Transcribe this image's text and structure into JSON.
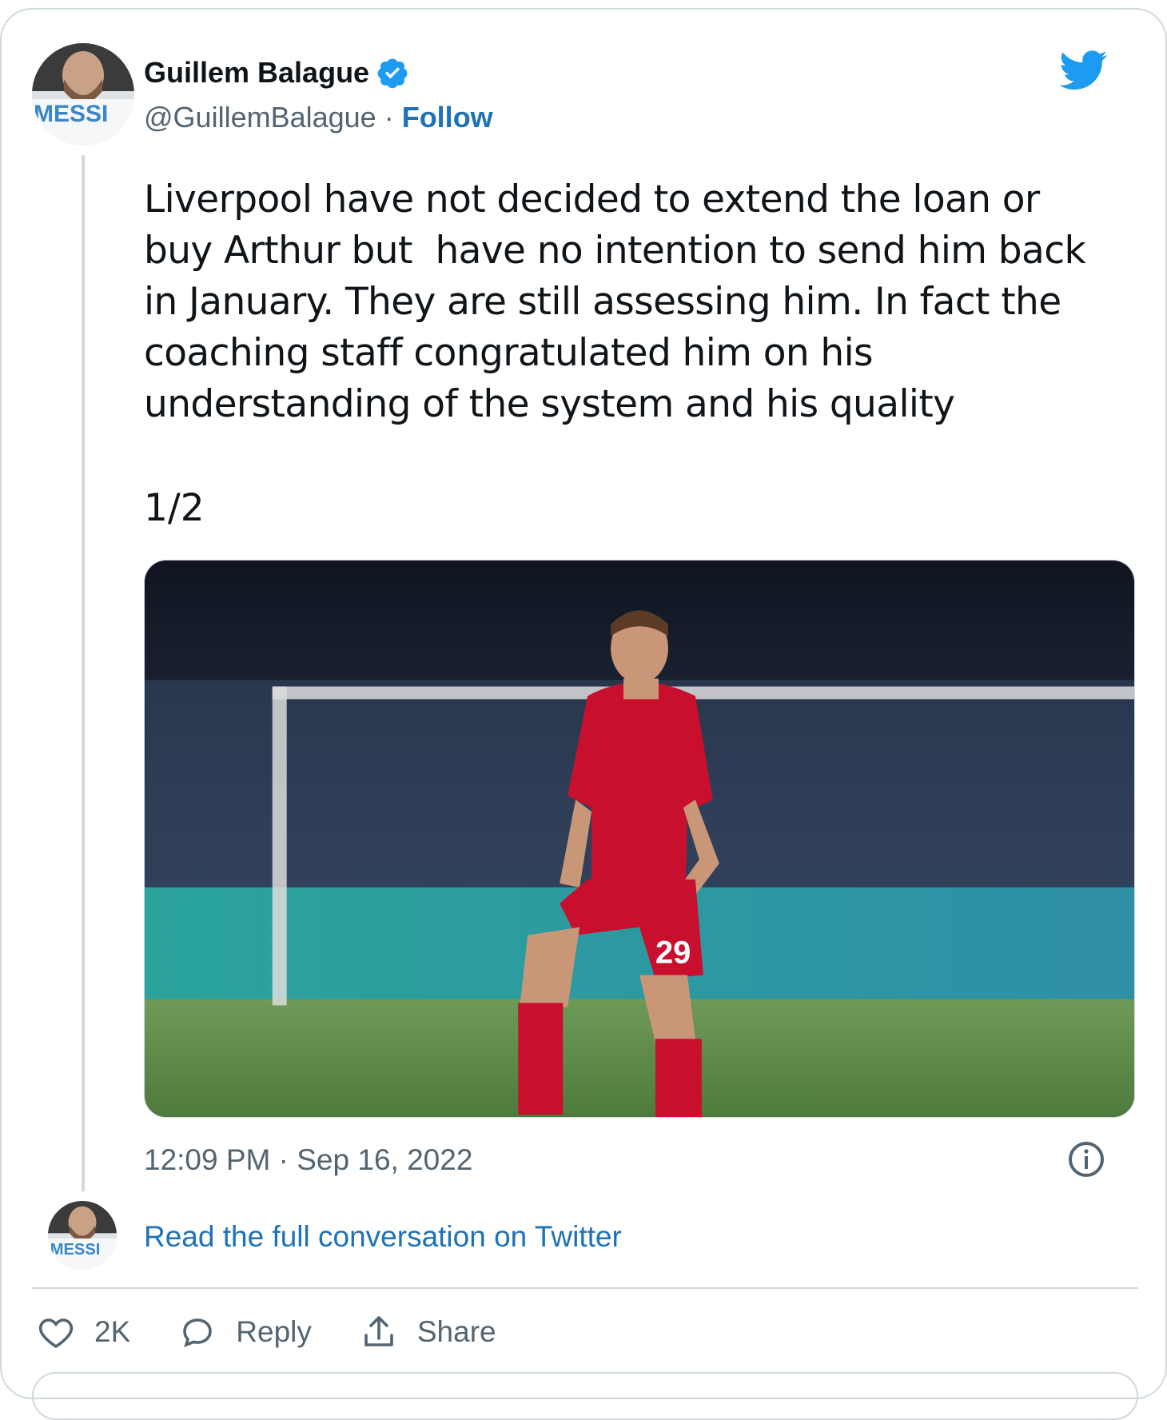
{
  "author": {
    "name": "Guillem Balague",
    "handle": "@GuillemBalague",
    "separator": " · ",
    "follow_label": "Follow",
    "avatar_shirt_text": "MESSI"
  },
  "tweet": {
    "text": "Liverpool have not decided to extend the loan or\nbuy Arthur but  have no intention to send him back\nin January. They are still assessing him. In fact the\ncoaching staff congratulated him on his\nunderstanding of the system and his quality",
    "thread_count": "1/2",
    "timestamp": "12:09 PM · Sep 16, 2022"
  },
  "photo": {
    "shirt_number": "29"
  },
  "read_more_label": "Read the full conversation on Twitter",
  "actions": {
    "like_count": "2K",
    "reply_label": "Reply",
    "share_label": "Share"
  },
  "icons": [
    "verified-badge-icon",
    "twitter-bird-icon",
    "info-icon",
    "heart-icon",
    "reply-bubble-icon",
    "share-icon"
  ],
  "colors": {
    "accent": "#1d9bf0",
    "link": "#1d72b8",
    "secondary_text": "#536471",
    "border": "#cfd9de",
    "kit_red": "#c8102e"
  }
}
